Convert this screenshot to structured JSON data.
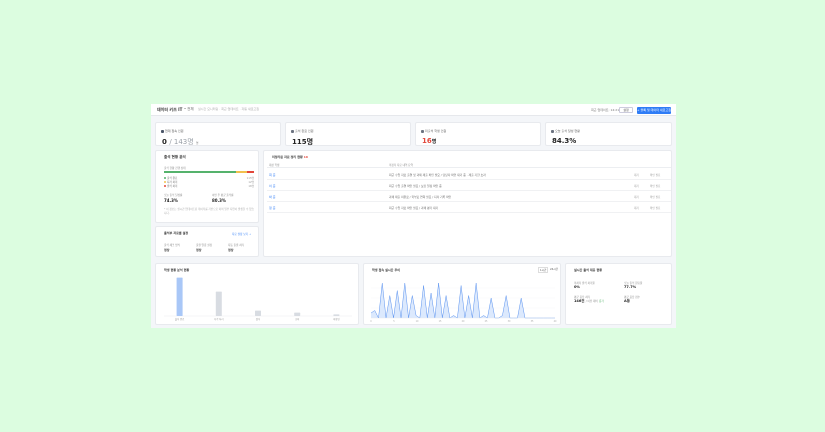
{
  "header": {
    "title": "데이터 키즈 IT",
    "select": "• 전체",
    "live": "실시간 모니터링 · 최근 업데이트 · 자동 새로고침",
    "updated": "최근 업데이트: 14:21",
    "settings_label": "설정",
    "add_button": "+ 블록 및 데이터 새로고침"
  },
  "kpis": [
    {
      "label": "현재 접속 인원",
      "value": "0",
      "sub": "/ 143명",
      "unit": "명",
      "icon_color": "#4a5568"
    },
    {
      "label": "출석 완료 인원",
      "value": "115명",
      "sub": "",
      "unit": "",
      "icon_color": "#6b7280"
    },
    {
      "label": "미출석 학생 인원",
      "value": "16",
      "sub": "",
      "unit": "명",
      "icon_color": "#6b7280",
      "red": true
    },
    {
      "label": "오늘 출석 달성 현황",
      "value": "84.3%",
      "sub": "",
      "unit": "",
      "icon_color": "#6b7280"
    }
  ],
  "status_card": {
    "title": "출석 현황 분석",
    "progress_label": "출석 현황 진행 상태",
    "progress_segments": [
      {
        "name": "출석",
        "fraction": 0.8,
        "color": "#55b26c"
      },
      {
        "name": "지각",
        "fraction": 0.12,
        "color": "#f2c14e"
      },
      {
        "name": "결석",
        "fraction": 0.08,
        "color": "#e2473b"
      }
    ],
    "legend": [
      {
        "label": "출석 완료",
        "value": "115명",
        "color": "#55b26c"
      },
      {
        "label": "지각 처리",
        "value": "12명",
        "color": "#f2c14e"
      },
      {
        "label": "결석 처리",
        "value": "16명",
        "color": "#e2473b"
      }
    ],
    "stat1_label": "오늘 출석 달성률",
    "stat1_value": "74.3%",
    "stat2_label": "이번 주 평균 출석률",
    "stat2_value": "80.3%",
    "note": "* 이 정보는 실시간 업데이트된 데이터를 기반으로 하며 일부 지연이 발생할 수 있습니다."
  },
  "class_card": {
    "title": "출석부 자료를 설정",
    "link": "자료 설정 보기 →",
    "items": [
      {
        "label": "출석 체크 방식",
        "value": "정상"
      },
      {
        "label": "출결 알림 설정",
        "value": "정상"
      },
      {
        "label": "자동 출결 처리",
        "value": "정상"
      }
    ]
  },
  "table_card": {
    "title": "미정리된 자료 정리 현황",
    "badge": "16",
    "col1": "대상 학생",
    "col2": "미정리 자료 내역 요약",
    "rows": [
      {
        "name": "최 준",
        "desc": "최근 수업 자료 출결 및 과제 제출 확인 필요 / 담당자 확인 대기 중 · 제출 기한 초과",
        "a": "대기",
        "b": "확인 필요"
      },
      {
        "name": "이 준",
        "desc": "최근 수업 출결 확인 필요 / 보강 일정 확인 중",
        "a": "대기",
        "b": "확인 필요"
      },
      {
        "name": "박 준",
        "desc": "과제 제출 미완료 / 학부모 연락 필요 / 지각 기록 확인",
        "a": "대기",
        "b": "확인 필요"
      },
      {
        "name": "정 준",
        "desc": "최근 수업 자료 확인 필요 / 과제 평가 대기",
        "a": "대기",
        "b": "확인 필요"
      }
    ]
  },
  "bar_card": {
    "title": "학생 현황 분석 현황",
    "chart_data": {
      "type": "bar",
      "categories": [
        "출석 완료",
        "지각 처리",
        "결석",
        "조퇴",
        "미확인"
      ],
      "values": [
        115,
        73,
        16,
        10,
        5
      ],
      "ylim": [
        0,
        120
      ],
      "grid": false
    }
  },
  "line_card": {
    "title": "학생 접속 실시간 추이",
    "btn1": "1시간",
    "btn2": "24시간",
    "chart_data": {
      "type": "line",
      "x": [
        "0",
        "5",
        "10",
        "15",
        "20",
        "25",
        "30",
        "35",
        "40"
      ],
      "values": [
        2,
        3,
        0,
        14,
        0,
        9,
        0,
        11,
        0,
        14,
        0,
        9,
        1,
        0,
        13,
        0,
        10,
        0,
        14,
        0,
        9,
        0,
        1,
        0,
        13,
        0,
        9,
        0,
        14,
        0,
        1,
        0,
        8,
        0,
        0,
        1,
        9,
        0,
        0,
        0,
        8,
        0,
        0,
        0,
        0,
        0,
        0,
        0,
        0,
        0
      ],
      "ylim": [
        0,
        16
      ],
      "grid": true
    }
  },
  "summary_card": {
    "title": "실시간 출석 대응 현황",
    "items": [
      {
        "label": "미처리 결석 처리율",
        "value": "0%"
      },
      {
        "label": "오늘 출석 완료율",
        "value": "77.7%"
      },
      {
        "label": "평균 응답 처리",
        "value": "146건",
        "sub": "/ 이전 대비",
        "extra": "증가"
      },
      {
        "label": "평균 응답 점수",
        "value": "A등"
      }
    ]
  }
}
